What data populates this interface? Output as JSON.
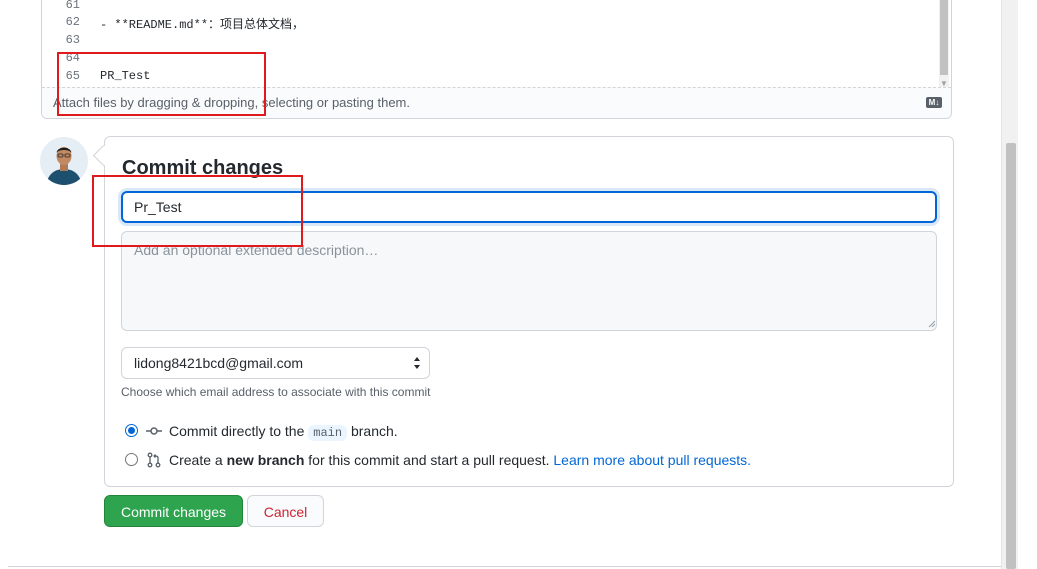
{
  "editor": {
    "lines": [
      {
        "num": "61",
        "code": ""
      },
      {
        "num": "62",
        "code": "- **README.md**：项目总体文档，"
      },
      {
        "num": "63",
        "code": ""
      },
      {
        "num": "64",
        "code": ""
      },
      {
        "num": "65",
        "code": "PR_Test"
      }
    ],
    "attach_hint": "Attach files by dragging & dropping, selecting or pasting them.",
    "markdown_icon": "markdown-icon"
  },
  "commit": {
    "title": "Commit changes",
    "summary_value": "Pr_Test",
    "description_placeholder": "Add an optional extended description…",
    "email_selected": "lidong8421bcd@gmail.com",
    "email_help": "Choose which email address to associate with this commit",
    "option_direct": {
      "prefix": "Commit directly to the ",
      "branch": "main",
      "suffix": " branch."
    },
    "option_new": {
      "prefix": "Create a ",
      "bold": "new branch",
      "middle": " for this commit and start a pull request. ",
      "link": "Learn more about pull requests."
    },
    "submit_label": "Commit changes",
    "cancel_label": "Cancel"
  },
  "colors": {
    "primary": "#2ea44f",
    "focus": "#0366d6",
    "danger": "#cb2431",
    "annotation": "#e0191c"
  }
}
